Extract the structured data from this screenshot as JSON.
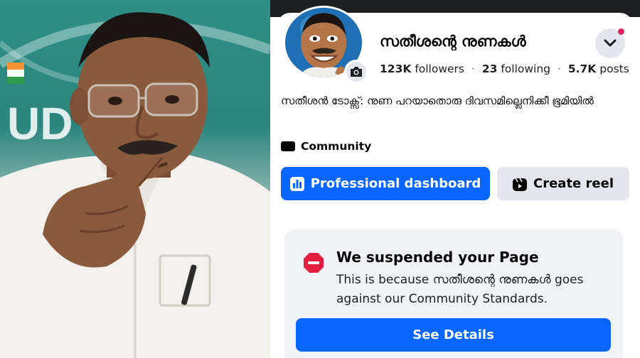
{
  "photo": {
    "backdrop_text": "UD",
    "colors": {
      "backdrop": "#2b857e",
      "shirt": "#f3f1ee",
      "skin": "#8a5a3c"
    }
  },
  "profile": {
    "page_name": "സതീശന്റെ നുണകൾ",
    "followers_count": "123K",
    "followers_label": "followers",
    "following_count": "23",
    "following_label": "following",
    "posts_count": "5.7K",
    "posts_label": "posts",
    "separator": "·",
    "bio": "സതീശൻ ടോക്സ്: നുണ പറയാതൊരു ദിവസമില്ലെനിക്കീ ഭൂമിയിൽ",
    "category": "Community",
    "avatar_icon": "cartoon-avatar",
    "camera_icon": "camera-icon",
    "menu_icon": "chevron-down-icon"
  },
  "actions": {
    "dashboard_label": "Professional dashboard",
    "reel_label": "Create reel"
  },
  "notice": {
    "title": "We suspended your Page",
    "message": "This is because സതീശന്റെ നുണകൾ goes against our Community Standards.",
    "button_label": "See Details",
    "icon": "no-entry-icon"
  },
  "colors": {
    "accent": "#0866ff",
    "secondary_button": "#e4e6eb",
    "card_background": "#f0f2f5",
    "warning": "#e41e3f",
    "notification_dot": "#e0245e"
  }
}
